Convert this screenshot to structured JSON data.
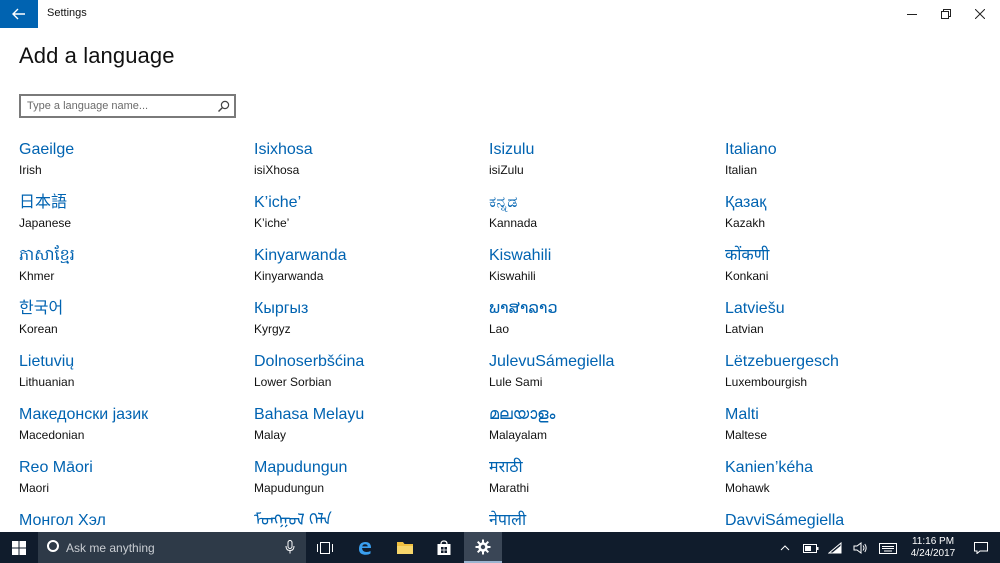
{
  "window": {
    "title": "Settings"
  },
  "page": {
    "title": "Add a language",
    "search_placeholder": "Type a language name..."
  },
  "languages": [
    {
      "native": "Gaeilge",
      "english": "Irish"
    },
    {
      "native": "Isixhosa",
      "english": "isiXhosa"
    },
    {
      "native": "Isizulu",
      "english": "isiZulu"
    },
    {
      "native": "Italiano",
      "english": "Italian"
    },
    {
      "native": "日本語",
      "english": "Japanese"
    },
    {
      "native": "K’iche’",
      "english": "K’iche’"
    },
    {
      "native": "ಕನ್ನಡ",
      "english": "Kannada"
    },
    {
      "native": "Қазақ",
      "english": "Kazakh"
    },
    {
      "native": "ភាសាខ្មែរ",
      "english": "Khmer"
    },
    {
      "native": "Kinyarwanda",
      "english": "Kinyarwanda"
    },
    {
      "native": "Kiswahili",
      "english": "Kiswahili"
    },
    {
      "native": "कोंकणी",
      "english": "Konkani"
    },
    {
      "native": "한국어",
      "english": "Korean"
    },
    {
      "native": "Кыргыз",
      "english": "Kyrgyz"
    },
    {
      "native": "ພາສາລາວ",
      "english": "Lao"
    },
    {
      "native": "Latviešu",
      "english": "Latvian"
    },
    {
      "native": "Lietuvių",
      "english": "Lithuanian"
    },
    {
      "native": "Dolnoserbšćina",
      "english": "Lower Sorbian"
    },
    {
      "native": "JulevuSámegiella",
      "english": "Lule Sami"
    },
    {
      "native": "Lëtzebuergesch",
      "english": "Luxembourgish"
    },
    {
      "native": "Македонски јазик",
      "english": "Macedonian"
    },
    {
      "native": "Bahasa Melayu",
      "english": "Malay"
    },
    {
      "native": "മലയാളം",
      "english": "Malayalam"
    },
    {
      "native": "Malti",
      "english": "Maltese"
    },
    {
      "native": "Reo Māori",
      "english": "Maori"
    },
    {
      "native": "Mapudungun",
      "english": "Mapudungun"
    },
    {
      "native": "मराठी",
      "english": "Marathi"
    },
    {
      "native": "Kanien’kéha",
      "english": "Mohawk"
    },
    {
      "native": "Монгол Хэл",
      "english": ""
    },
    {
      "native": "ᠮᠣᠩᠭᠣᠯ ᠬᠡᠯᠡ",
      "english": ""
    },
    {
      "native": "नेपाली",
      "english": ""
    },
    {
      "native": "DavviSámegiella",
      "english": ""
    }
  ],
  "taskbar": {
    "search_placeholder": "Ask me anything",
    "time": "11:16 PM",
    "date": "4/24/2017"
  },
  "colors": {
    "accent": "#0063b1",
    "taskbar": "#101c2c",
    "search_box": "#2e3a48"
  }
}
